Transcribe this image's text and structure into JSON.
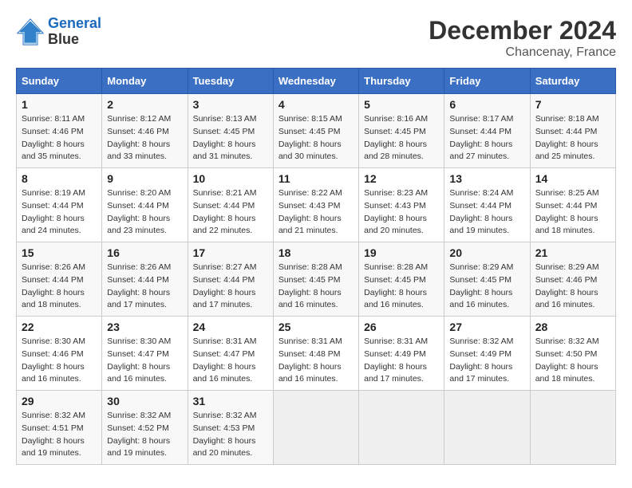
{
  "logo": {
    "line1": "General",
    "line2": "Blue"
  },
  "title": "December 2024",
  "subtitle": "Chancenay, France",
  "days_header": [
    "Sunday",
    "Monday",
    "Tuesday",
    "Wednesday",
    "Thursday",
    "Friday",
    "Saturday"
  ],
  "weeks": [
    [
      {
        "day": "1",
        "sunrise": "8:11 AM",
        "sunset": "4:46 PM",
        "daylight": "8 hours and 35 minutes."
      },
      {
        "day": "2",
        "sunrise": "8:12 AM",
        "sunset": "4:46 PM",
        "daylight": "8 hours and 33 minutes."
      },
      {
        "day": "3",
        "sunrise": "8:13 AM",
        "sunset": "4:45 PM",
        "daylight": "8 hours and 31 minutes."
      },
      {
        "day": "4",
        "sunrise": "8:15 AM",
        "sunset": "4:45 PM",
        "daylight": "8 hours and 30 minutes."
      },
      {
        "day": "5",
        "sunrise": "8:16 AM",
        "sunset": "4:45 PM",
        "daylight": "8 hours and 28 minutes."
      },
      {
        "day": "6",
        "sunrise": "8:17 AM",
        "sunset": "4:44 PM",
        "daylight": "8 hours and 27 minutes."
      },
      {
        "day": "7",
        "sunrise": "8:18 AM",
        "sunset": "4:44 PM",
        "daylight": "8 hours and 25 minutes."
      }
    ],
    [
      {
        "day": "8",
        "sunrise": "8:19 AM",
        "sunset": "4:44 PM",
        "daylight": "8 hours and 24 minutes."
      },
      {
        "day": "9",
        "sunrise": "8:20 AM",
        "sunset": "4:44 PM",
        "daylight": "8 hours and 23 minutes."
      },
      {
        "day": "10",
        "sunrise": "8:21 AM",
        "sunset": "4:44 PM",
        "daylight": "8 hours and 22 minutes."
      },
      {
        "day": "11",
        "sunrise": "8:22 AM",
        "sunset": "4:43 PM",
        "daylight": "8 hours and 21 minutes."
      },
      {
        "day": "12",
        "sunrise": "8:23 AM",
        "sunset": "4:43 PM",
        "daylight": "8 hours and 20 minutes."
      },
      {
        "day": "13",
        "sunrise": "8:24 AM",
        "sunset": "4:44 PM",
        "daylight": "8 hours and 19 minutes."
      },
      {
        "day": "14",
        "sunrise": "8:25 AM",
        "sunset": "4:44 PM",
        "daylight": "8 hours and 18 minutes."
      }
    ],
    [
      {
        "day": "15",
        "sunrise": "8:26 AM",
        "sunset": "4:44 PM",
        "daylight": "8 hours and 18 minutes."
      },
      {
        "day": "16",
        "sunrise": "8:26 AM",
        "sunset": "4:44 PM",
        "daylight": "8 hours and 17 minutes."
      },
      {
        "day": "17",
        "sunrise": "8:27 AM",
        "sunset": "4:44 PM",
        "daylight": "8 hours and 17 minutes."
      },
      {
        "day": "18",
        "sunrise": "8:28 AM",
        "sunset": "4:45 PM",
        "daylight": "8 hours and 16 minutes."
      },
      {
        "day": "19",
        "sunrise": "8:28 AM",
        "sunset": "4:45 PM",
        "daylight": "8 hours and 16 minutes."
      },
      {
        "day": "20",
        "sunrise": "8:29 AM",
        "sunset": "4:45 PM",
        "daylight": "8 hours and 16 minutes."
      },
      {
        "day": "21",
        "sunrise": "8:29 AM",
        "sunset": "4:46 PM",
        "daylight": "8 hours and 16 minutes."
      }
    ],
    [
      {
        "day": "22",
        "sunrise": "8:30 AM",
        "sunset": "4:46 PM",
        "daylight": "8 hours and 16 minutes."
      },
      {
        "day": "23",
        "sunrise": "8:30 AM",
        "sunset": "4:47 PM",
        "daylight": "8 hours and 16 minutes."
      },
      {
        "day": "24",
        "sunrise": "8:31 AM",
        "sunset": "4:47 PM",
        "daylight": "8 hours and 16 minutes."
      },
      {
        "day": "25",
        "sunrise": "8:31 AM",
        "sunset": "4:48 PM",
        "daylight": "8 hours and 16 minutes."
      },
      {
        "day": "26",
        "sunrise": "8:31 AM",
        "sunset": "4:49 PM",
        "daylight": "8 hours and 17 minutes."
      },
      {
        "day": "27",
        "sunrise": "8:32 AM",
        "sunset": "4:49 PM",
        "daylight": "8 hours and 17 minutes."
      },
      {
        "day": "28",
        "sunrise": "8:32 AM",
        "sunset": "4:50 PM",
        "daylight": "8 hours and 18 minutes."
      }
    ],
    [
      {
        "day": "29",
        "sunrise": "8:32 AM",
        "sunset": "4:51 PM",
        "daylight": "8 hours and 19 minutes."
      },
      {
        "day": "30",
        "sunrise": "8:32 AM",
        "sunset": "4:52 PM",
        "daylight": "8 hours and 19 minutes."
      },
      {
        "day": "31",
        "sunrise": "8:32 AM",
        "sunset": "4:53 PM",
        "daylight": "8 hours and 20 minutes."
      },
      null,
      null,
      null,
      null
    ]
  ],
  "labels": {
    "sunrise": "Sunrise:",
    "sunset": "Sunset:",
    "daylight": "Daylight:"
  }
}
